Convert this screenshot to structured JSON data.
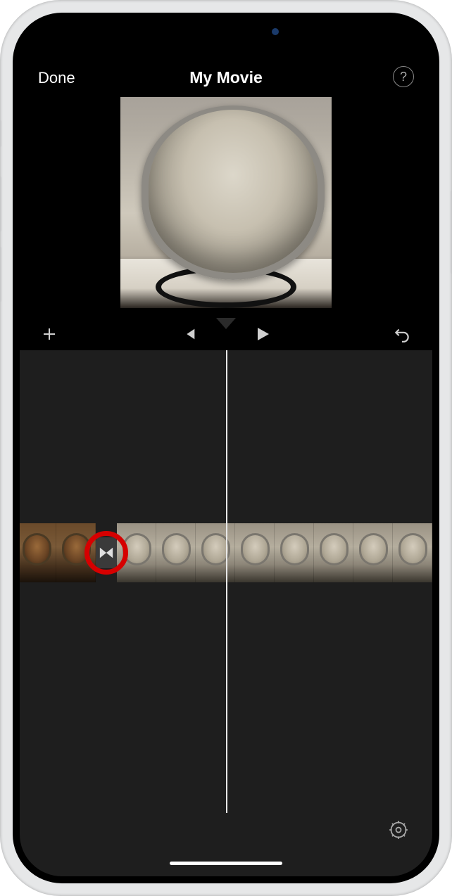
{
  "header": {
    "done_label": "Done",
    "title": "My Movie",
    "help_label": "?"
  },
  "toolbar": {
    "add_icon": "plus",
    "prev_icon": "skip-back",
    "play_icon": "play",
    "undo_icon": "undo"
  },
  "timeline": {
    "clip1_thumbnails": 2,
    "clip2_thumbnails": 8,
    "transition_icon": "transition-bowtie"
  },
  "footer": {
    "settings_icon": "gear"
  },
  "annotation": {
    "highlight": "red-circle-on-transition"
  }
}
